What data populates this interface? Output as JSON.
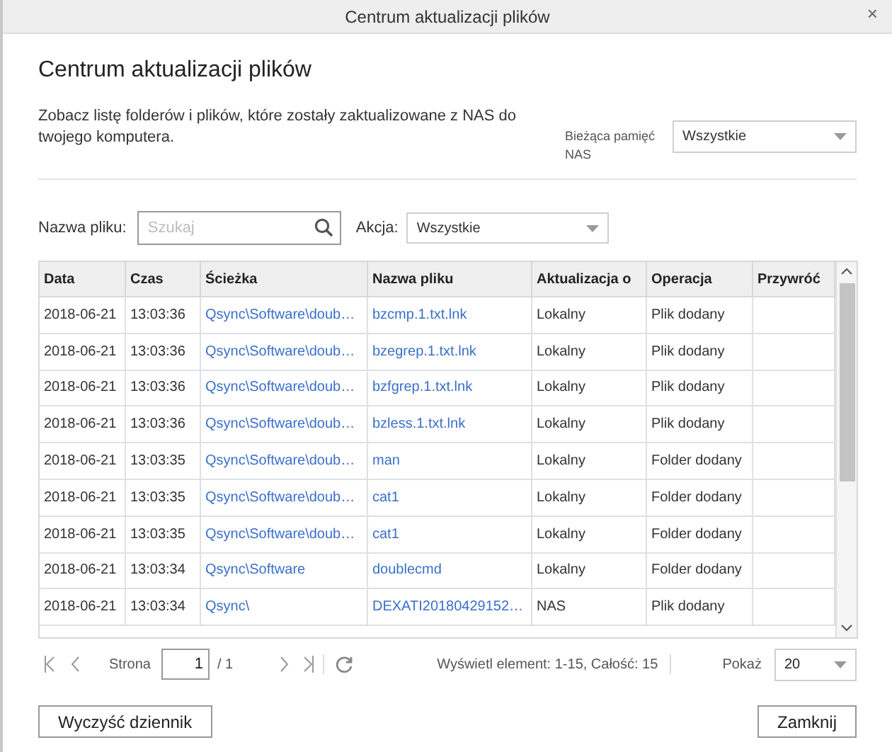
{
  "window": {
    "title": "Centrum aktualizacji plików",
    "close": "×"
  },
  "heading": "Centrum aktualizacji plików",
  "description": "Zobacz listę folderów i plików, które zostały zaktualizowane z NAS do twojego komputera.",
  "storage": {
    "label": "Bieżąca pamięć NAS",
    "value": "Wszystkie"
  },
  "filters": {
    "filename_label": "Nazwa pliku:",
    "filename_placeholder": "Szukaj",
    "action_label": "Akcja:",
    "action_value": "Wszystkie"
  },
  "table": {
    "columns": [
      "Data",
      "Czas",
      "Ścieżka",
      "Nazwa pliku",
      "Aktualizacja o",
      "Operacja",
      "Przywróć"
    ],
    "rows": [
      [
        "2018-06-21",
        "13:03:36",
        "Qsync\\Software\\doub…",
        "bzcmp.1.txt.lnk",
        "Lokalny",
        "Plik dodany",
        ""
      ],
      [
        "2018-06-21",
        "13:03:36",
        "Qsync\\Software\\doub…",
        "bzegrep.1.txt.lnk",
        "Lokalny",
        "Plik dodany",
        ""
      ],
      [
        "2018-06-21",
        "13:03:36",
        "Qsync\\Software\\doub…",
        "bzfgrep.1.txt.lnk",
        "Lokalny",
        "Plik dodany",
        ""
      ],
      [
        "2018-06-21",
        "13:03:36",
        "Qsync\\Software\\doub…",
        "bzless.1.txt.lnk",
        "Lokalny",
        "Plik dodany",
        ""
      ],
      [
        "2018-06-21",
        "13:03:35",
        "Qsync\\Software\\doub…",
        "man",
        "Lokalny",
        "Folder dodany",
        ""
      ],
      [
        "2018-06-21",
        "13:03:35",
        "Qsync\\Software\\doub…",
        "cat1",
        "Lokalny",
        "Folder dodany",
        ""
      ],
      [
        "2018-06-21",
        "13:03:35",
        "Qsync\\Software\\doub…",
        "cat1",
        "Lokalny",
        "Folder dodany",
        ""
      ],
      [
        "2018-06-21",
        "13:03:34",
        "Qsync\\Software",
        "doublecmd",
        "Lokalny",
        "Folder dodany",
        ""
      ],
      [
        "2018-06-21",
        "13:03:34",
        "Qsync\\",
        "DEXATI20180429152…",
        "NAS",
        "Plik dodany",
        ""
      ]
    ]
  },
  "pagination": {
    "page_label": "Strona",
    "page": "1",
    "total_pages": "/ 1",
    "summary": "Wyświetl element: 1-15, Całość: 15",
    "show_label": "Pokaż",
    "show_value": "20"
  },
  "buttons": {
    "clear": "Wyczyść dziennik",
    "close": "Zamknij"
  }
}
